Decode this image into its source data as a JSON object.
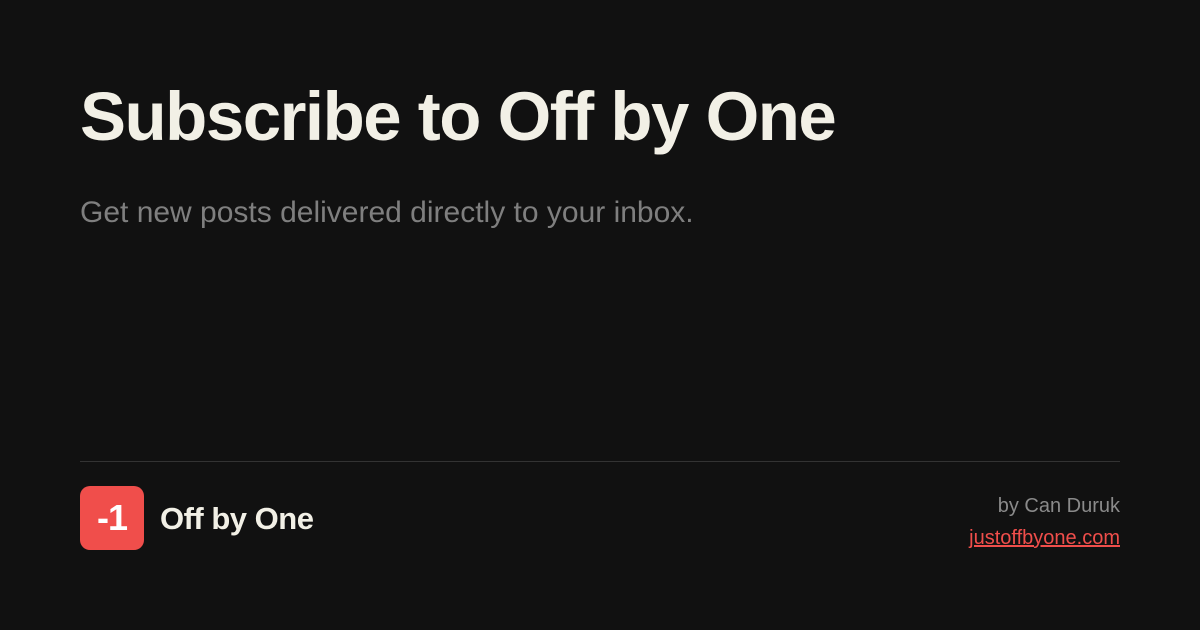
{
  "header": {
    "title": "Subscribe to Off by One",
    "subtitle": "Get new posts delivered directly to your inbox."
  },
  "footer": {
    "logo_text": "-1",
    "brand_name": "Off by One",
    "byline": "by Can Duruk",
    "site_link": "justoffbyone.com"
  },
  "colors": {
    "background": "#111111",
    "title": "#f2f0e6",
    "subtitle": "#7f7f7f",
    "accent": "#f04e4b",
    "divider": "#333333"
  }
}
